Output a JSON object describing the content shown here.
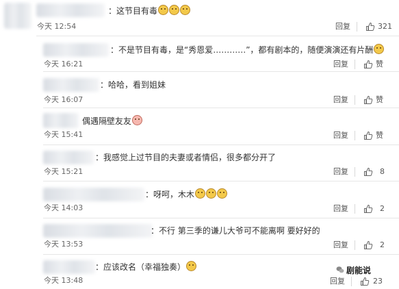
{
  "comments": [
    {
      "text": "：这节目有毒",
      "emoji_count": 3,
      "time": "今天 12:54",
      "reply": "回复",
      "likes": "321"
    },
    {
      "text": "：不是节目有毒，是“秀恩爱…………”，都有剧本的，随便演演还有片酬",
      "emoji_count": 1,
      "time": "今天 16:21",
      "reply": "回复",
      "likes": "赞"
    },
    {
      "text": "：哈哈，看到姐妹",
      "emoji_count": 0,
      "time": "今天 16:07",
      "reply": "回复",
      "likes": "赞"
    },
    {
      "text": "偶遇隔壁友友",
      "emoji_count": 1,
      "time": "今天 15:41",
      "reply": "回复",
      "likes": "赞"
    },
    {
      "text": "：我感觉上过节目的夫妻或者情侣，很多都分开了",
      "emoji_count": 0,
      "time": "今天 15:21",
      "reply": "回复",
      "likes": "8"
    },
    {
      "text": "：呀呵，木木",
      "emoji_count": 3,
      "time": "今天 14:03",
      "reply": "回复",
      "likes": "2"
    },
    {
      "text": "：不行 第三季的谦儿大爷可不能离啊 要好好的",
      "emoji_count": 0,
      "time": "今天 13:53",
      "reply": "回复",
      "likes": "2"
    },
    {
      "text": "：应该改名（幸福独奏）",
      "emoji_count": 1,
      "time": "今天 13:48",
      "reply": "回复",
      "likes": "23"
    }
  ],
  "watermark": {
    "text": "剧能说",
    "icon": "wechat-icon"
  },
  "colors": {
    "background": "#ffffff",
    "text": "#333333",
    "meta": "#666666",
    "divider": "#e6e6e6"
  }
}
